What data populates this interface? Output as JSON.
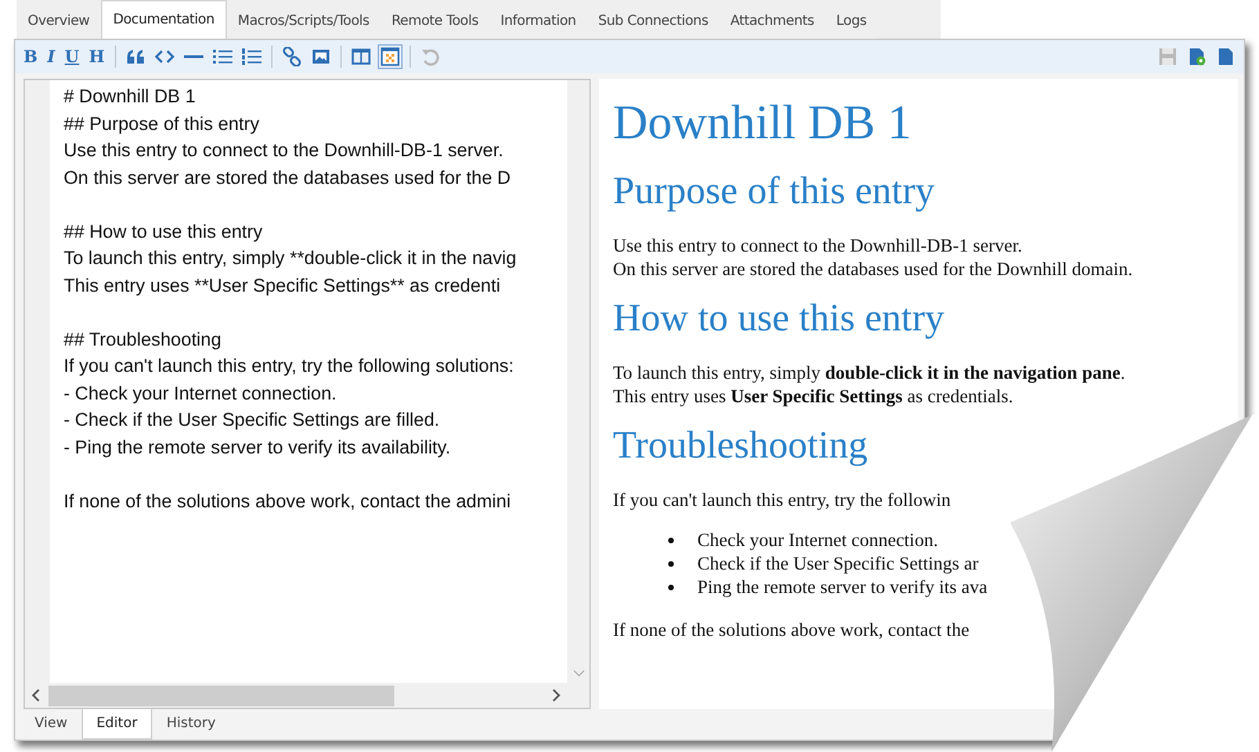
{
  "tabs": [
    {
      "label": "Overview",
      "selected": false
    },
    {
      "label": "Documentation",
      "selected": true
    },
    {
      "label": "Macros/Scripts/Tools",
      "selected": false
    },
    {
      "label": "Remote Tools",
      "selected": false
    },
    {
      "label": "Information",
      "selected": false
    },
    {
      "label": "Sub Connections",
      "selected": false
    },
    {
      "label": "Attachments",
      "selected": false
    },
    {
      "label": "Logs",
      "selected": false
    }
  ],
  "toolbar": {
    "format_buttons": [
      "B",
      "I",
      "U",
      "H"
    ]
  },
  "editor": {
    "paragraphs": [
      [
        "# Downhill DB 1",
        "## Purpose of this entry",
        "Use this entry to connect to the Downhill-DB-1 server.",
        "On this server are stored the databases used for the D"
      ],
      [
        "## How to use this entry",
        "To launch this entry, simply **double-click it in the navig",
        "This entry uses **User Specific Settings** as credenti"
      ],
      [
        "## Troubleshooting",
        "If you can't launch this entry, try the following solutions:",
        "- Check your Internet connection.",
        "- Check if the User Specific Settings are filled.",
        "- Ping the remote server to verify its availability."
      ],
      [
        "If none of the solutions above work, contact the admini"
      ]
    ]
  },
  "preview": {
    "blocks": [
      {
        "kind": "h1",
        "text": "Downhill DB 1"
      },
      {
        "kind": "h2",
        "text": "Purpose of this entry"
      },
      {
        "kind": "p",
        "lines": [
          "Use this entry to connect to the Downhill-DB-1 server.",
          "On this server are stored the databases used for the Downhill domain."
        ]
      },
      {
        "kind": "h2",
        "text": "How to use this entry"
      },
      {
        "kind": "p",
        "lines": [
          "To launch this entry, simply **double-click it in the navigation pane**.",
          "This entry uses **User Specific Settings** as credentials."
        ]
      },
      {
        "kind": "h2",
        "text": "Troubleshooting"
      },
      {
        "kind": "p",
        "lines": [
          "If you can't launch this entry, try the followin"
        ]
      },
      {
        "kind": "ul",
        "items": [
          "Check your Internet connection.",
          "Check if the User Specific Settings ar",
          "Ping the remote server to verify its ava"
        ]
      },
      {
        "kind": "p",
        "lines": [
          "If none of the solutions above work, contact the"
        ]
      }
    ]
  },
  "bottom_tabs": [
    {
      "label": "View",
      "selected": false
    },
    {
      "label": "Editor",
      "selected": true
    },
    {
      "label": "History",
      "selected": false
    }
  ]
}
